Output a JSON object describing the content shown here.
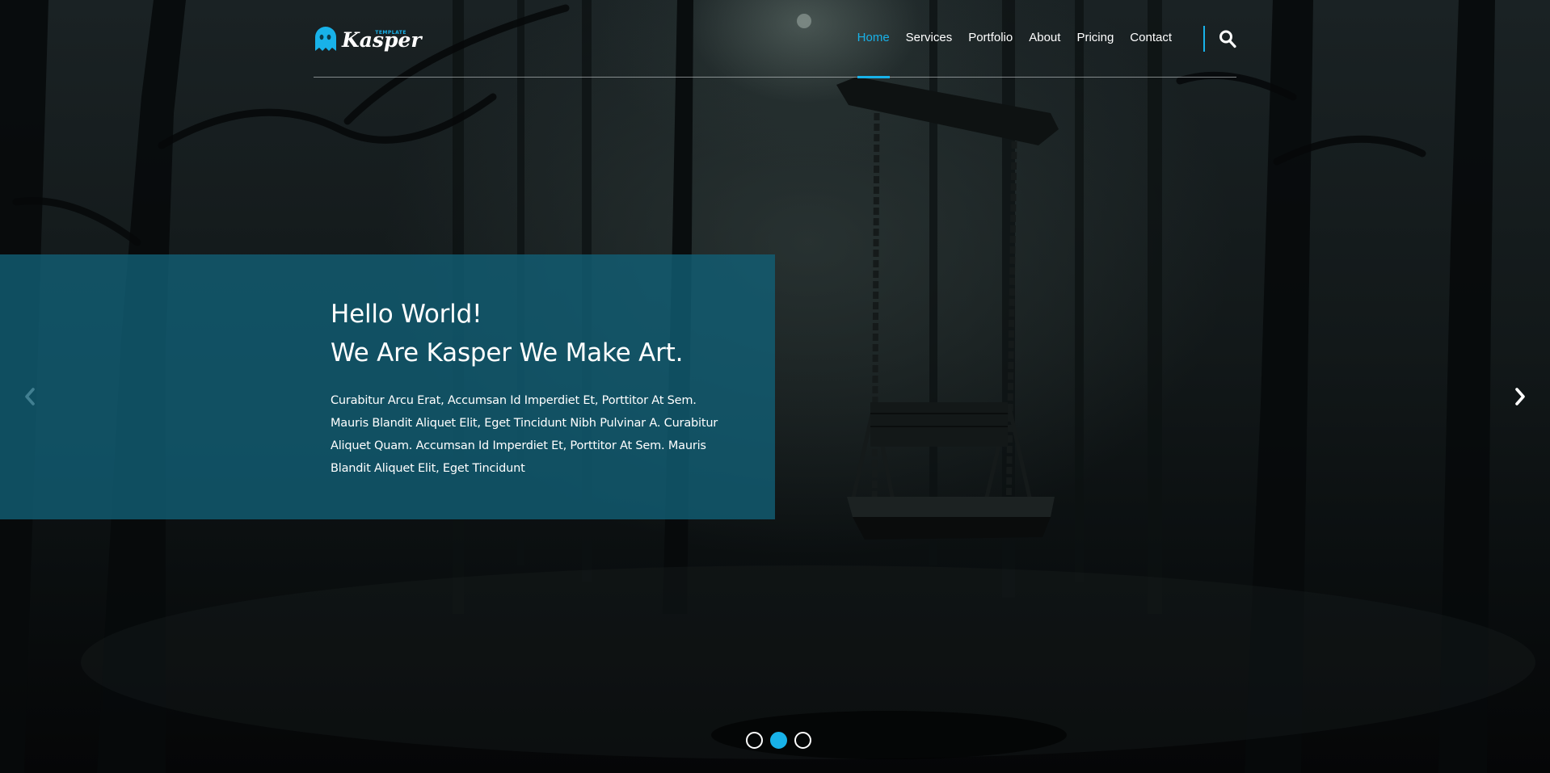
{
  "brand": {
    "logo_small": "TEMPLATE",
    "logo_word": "Kasper",
    "accent_color": "#18b2e9"
  },
  "nav": {
    "items": [
      {
        "label": "Home",
        "active": true
      },
      {
        "label": "Services",
        "active": false
      },
      {
        "label": "Portfolio",
        "active": false
      },
      {
        "label": "About",
        "active": false
      },
      {
        "label": "Pricing",
        "active": false
      },
      {
        "label": "Contact",
        "active": false
      }
    ],
    "search_icon": "search-icon"
  },
  "slider": {
    "heading_line1": "Hello World!",
    "heading_line2": "We Are Kasper We Make Art.",
    "text": "Curabitur Arcu Erat, Accumsan Id Imperdiet Et, Porttitor At Sem. Mauris Blandit Aliquet Elit, Eget Tincidunt Nibh Pulvinar A. Curabitur Aliquet Quam. Accumsan Id Imperdiet Et, Porttitor At Sem. Mauris Blandit Aliquet Elit, Eget Tincidunt",
    "prev_icon": "chevron-left-icon",
    "next_icon": "chevron-right-icon",
    "slide_count": 3,
    "active_slide": 2
  }
}
